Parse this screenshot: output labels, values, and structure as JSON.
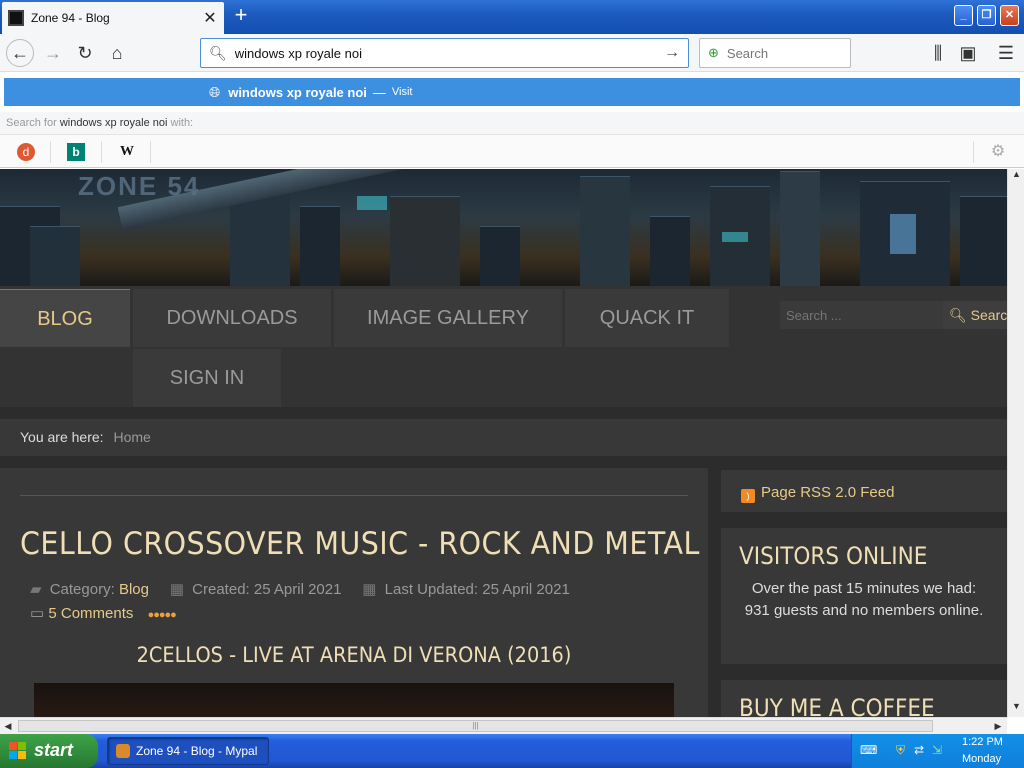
{
  "browser": {
    "tab_title": "Zone 94 - Blog",
    "url_value": "windows xp royale noi",
    "search_placeholder": "Search",
    "suggestion": {
      "text": "windows xp royale noi",
      "separator": "—",
      "action": "Visit"
    },
    "search_for": {
      "prefix": "Search for",
      "query": "windows xp royale noi",
      "suffix": "with:"
    },
    "engines": [
      "DuckDuckGo",
      "Bing",
      "Wikipedia"
    ]
  },
  "site": {
    "logo_text": "ZONE 54",
    "nav": [
      "BLOG",
      "DOWNLOADS",
      "IMAGE GALLERY",
      "QUACK IT",
      "SIGN IN"
    ],
    "search_placeholder": "Search ...",
    "search_button": "Search",
    "breadcrumb": {
      "label": "You are here:",
      "home": "Home"
    },
    "article": {
      "title": "CELLO CROSSOVER MUSIC - ROCK AND METAL",
      "category_label": "Category:",
      "category": "Blog",
      "created": "Created: 25 April 2021",
      "updated": "Last Updated: 25 April 2021",
      "comments": "5 Comments",
      "rating_stars": 5,
      "video_title": "2CELLOS - LIVE AT ARENA DI VERONA (2016)"
    },
    "sidebar": {
      "rss": "Page RSS 2.0 Feed",
      "visitors_title": "VISITORS ONLINE",
      "visitors_text": "Over the past 15 minutes we had: 931 guests and no members online.",
      "coffee_title": "BUY ME A COFFEE"
    }
  },
  "taskbar": {
    "start": "start",
    "task_item": "Zone 94 - Blog - Mypal",
    "time": "1:22 PM",
    "day": "Monday"
  }
}
